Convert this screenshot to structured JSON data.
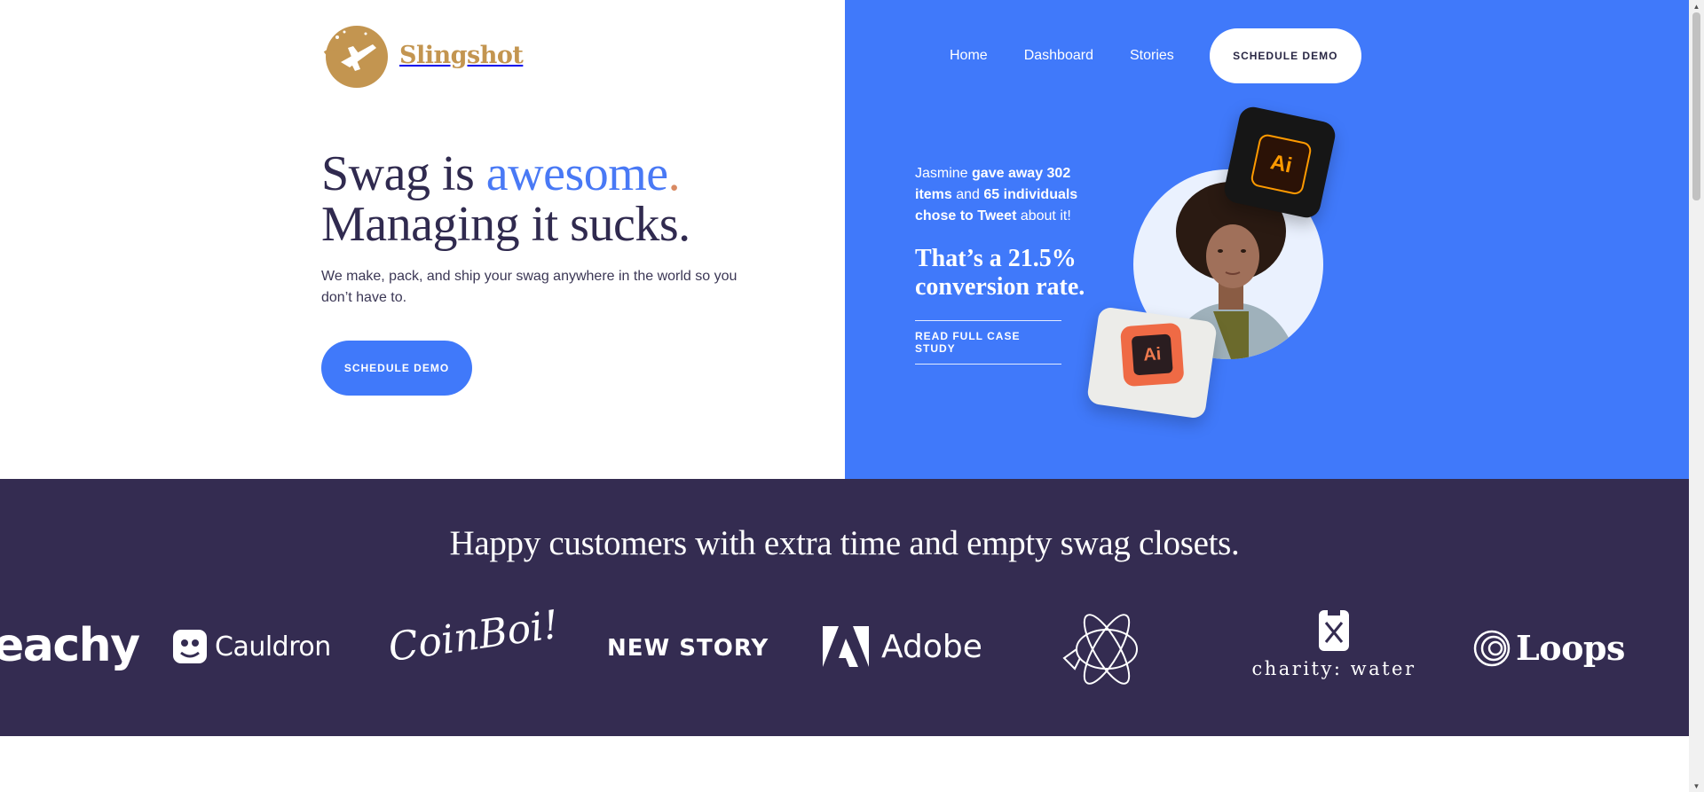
{
  "brand": {
    "name": "Slingshot",
    "color": "#c39550"
  },
  "colors": {
    "primary_blue": "#4079fa",
    "navy": "#342c51",
    "headline": "#302a4f"
  },
  "hero": {
    "headline_part1": "Swag is ",
    "headline_accent": "awesome",
    "headline_dot": ".",
    "headline_line2": "Managing it sucks.",
    "subcopy": "We make, pack, and ship your swag anywhere in the world so you don’t have to.",
    "cta_label": "SCHEDULE DEMO"
  },
  "nav": {
    "items": [
      {
        "label": "Home"
      },
      {
        "label": "Dashboard"
      },
      {
        "label": "Stories"
      }
    ],
    "cta_label": "SCHEDULE DEMO"
  },
  "case_study": {
    "t1": "Jasmine ",
    "t2": "gave away 302 items",
    "t3": " and ",
    "t4": "65 individuals chose to Tweet",
    "t5": " about it!",
    "stat_line1": "That’s a 21.5%",
    "stat_line2": "conversion rate.",
    "link_label": "READ FULL CASE STUDY",
    "tile_label": "Ai"
  },
  "customers": {
    "title": "Happy customers with extra time and empty swag closets.",
    "logos": [
      {
        "name": "eachy",
        "icon": "peachy-wordmark"
      },
      {
        "name": "Cauldron",
        "icon": "cauldron-mark-icon"
      },
      {
        "name": "CoinBoi!",
        "icon": "coinboi-script-wordmark"
      },
      {
        "name": "NEW STORY",
        "icon": "newstory-wordmark"
      },
      {
        "name": "Adobe",
        "icon": "adobe-mark-icon"
      },
      {
        "name": "",
        "icon": "blimp-logo-icon"
      },
      {
        "name": "charity: water",
        "icon": "jerrycan-icon"
      },
      {
        "name": "Loops",
        "icon": "loops-rings-icon"
      }
    ]
  }
}
